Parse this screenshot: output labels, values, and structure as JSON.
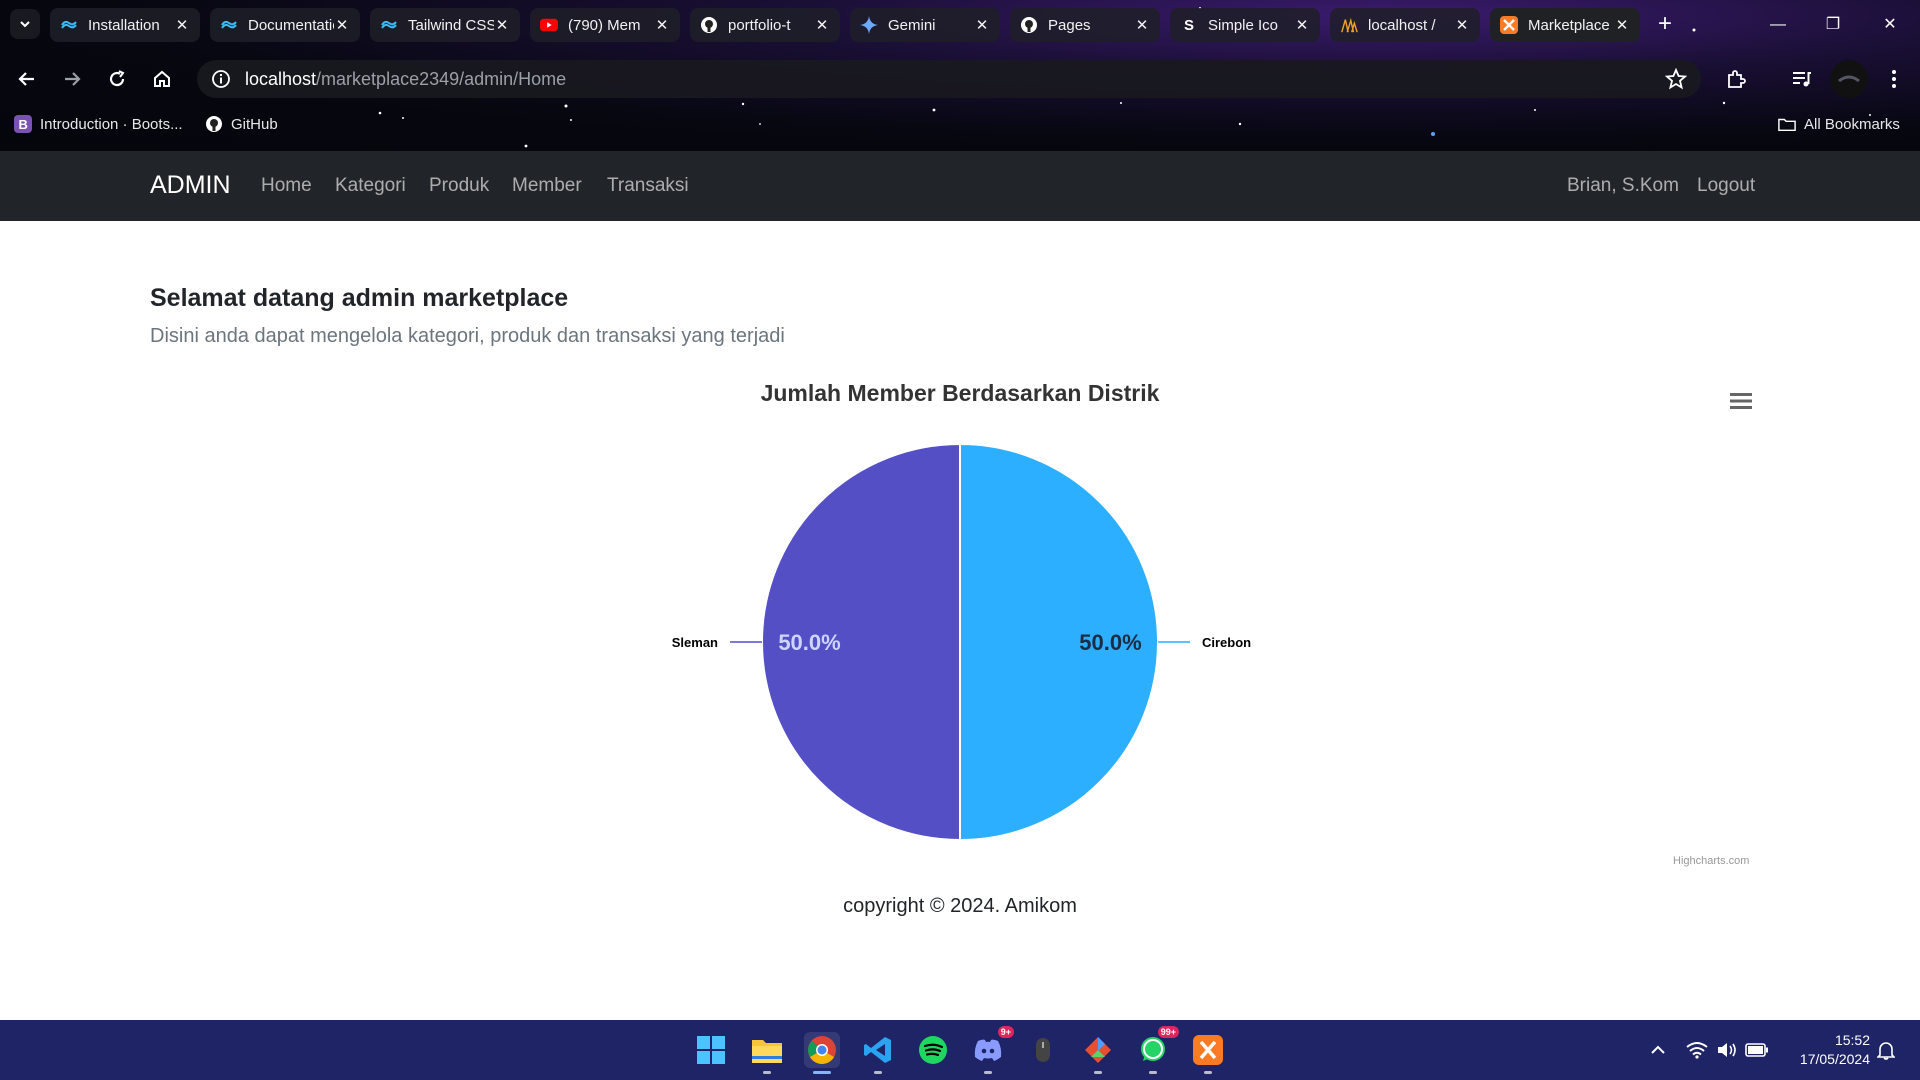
{
  "browser": {
    "tabs": [
      {
        "title": "Installation",
        "icon": "tailwind-icon"
      },
      {
        "title": "Documentation",
        "icon": "tailwind-icon"
      },
      {
        "title": "Tailwind CSS",
        "icon": "tailwind-icon"
      },
      {
        "title": "(790) Mem",
        "icon": "youtube-icon"
      },
      {
        "title": "portfolio-t",
        "icon": "github-icon"
      },
      {
        "title": "Gemini",
        "icon": "gemini-icon"
      },
      {
        "title": "Pages",
        "icon": "github-icon"
      },
      {
        "title": "Simple Ico",
        "icon": "simpleicons-icon"
      },
      {
        "title": "localhost /",
        "icon": "phpmyadmin-icon"
      },
      {
        "title": "Marketplace",
        "icon": "xampp-icon",
        "active": true
      }
    ],
    "url_host": "localhost",
    "url_path": "/marketplace2349/admin/Home",
    "bookmarks": [
      {
        "label": "Introduction · Boots...",
        "icon": "bootstrap-icon"
      },
      {
        "label": "GitHub",
        "icon": "github-icon"
      }
    ],
    "all_bookmarks_label": "All Bookmarks"
  },
  "navbar": {
    "brand": "ADMIN",
    "links": [
      "Home",
      "Kategori",
      "Produk",
      "Member",
      "Transaksi"
    ],
    "user": "Brian, S.Kom",
    "logout": "Logout"
  },
  "main": {
    "heading": "Selamat datang admin marketplace",
    "lead": "Disini anda dapat mengelola kategori, produk dan transaksi yang terjadi"
  },
  "chart_data": {
    "type": "pie",
    "title": "Jumlah Member Berdasarkan Distrik",
    "series": [
      {
        "name": "Sleman",
        "value": 50.0,
        "label": "50.0%",
        "color": "#544fc5"
      },
      {
        "name": "Cirebon",
        "value": 50.0,
        "label": "50.0%",
        "color": "#2caffe"
      }
    ],
    "credits": "Highcharts.com",
    "menu_icon": "hamburger-icon"
  },
  "footer": {
    "text": "copyright © 2024. Amikom"
  },
  "taskbar": {
    "apps": [
      "windows-start-icon",
      "file-explorer-icon",
      "chrome-icon",
      "vscode-icon",
      "spotify-icon",
      "discord-icon",
      "mouse-app-icon",
      "git-icon",
      "whatsapp-icon",
      "xampp-icon"
    ],
    "discord_badge": "9+",
    "whatsapp_badge": "99+",
    "time": "15:52",
    "date": "17/05/2024"
  },
  "colors": {
    "navbar_bg": "#212529",
    "taskbar_bg": "#1e2466",
    "accent_blue": "#2caffe",
    "accent_purple": "#544fc5"
  }
}
